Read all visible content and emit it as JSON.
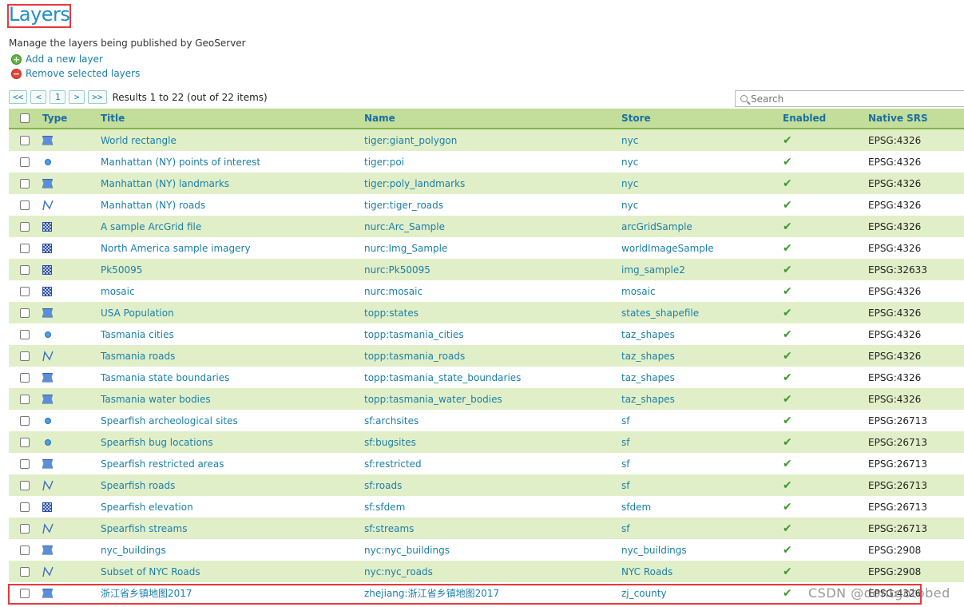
{
  "page": {
    "title": "Layers",
    "subtitle": "Manage the layers being published by GeoServer",
    "add_label": "Add a new layer",
    "remove_label": "Remove selected layers"
  },
  "pager": {
    "first": "<<",
    "prev": "<",
    "current": "1",
    "next": ">",
    "last": ">>",
    "results": "Results 1 to 22 (out of 22 items)"
  },
  "search": {
    "placeholder": "Search"
  },
  "columns": {
    "type": "Type",
    "title": "Title",
    "name": "Name",
    "store": "Store",
    "enabled": "Enabled",
    "srs": "Native SRS"
  },
  "enabled_mark": "✔",
  "rows": [
    {
      "type": "polygon",
      "title": "World rectangle",
      "name": "tiger:giant_polygon",
      "store": "nyc",
      "srs": "EPSG:4326"
    },
    {
      "type": "point",
      "title": "Manhattan (NY) points of interest",
      "name": "tiger:poi",
      "store": "nyc",
      "srs": "EPSG:4326"
    },
    {
      "type": "polygon",
      "title": "Manhattan (NY) landmarks",
      "name": "tiger:poly_landmarks",
      "store": "nyc",
      "srs": "EPSG:4326"
    },
    {
      "type": "line",
      "title": "Manhattan (NY) roads",
      "name": "tiger:tiger_roads",
      "store": "nyc",
      "srs": "EPSG:4326"
    },
    {
      "type": "raster",
      "title": "A sample ArcGrid file",
      "name": "nurc:Arc_Sample",
      "store": "arcGridSample",
      "srs": "EPSG:4326"
    },
    {
      "type": "raster",
      "title": "North America sample imagery",
      "name": "nurc:Img_Sample",
      "store": "worldImageSample",
      "srs": "EPSG:4326"
    },
    {
      "type": "raster",
      "title": "Pk50095",
      "name": "nurc:Pk50095",
      "store": "img_sample2",
      "srs": "EPSG:32633"
    },
    {
      "type": "raster",
      "title": "mosaic",
      "name": "nurc:mosaic",
      "store": "mosaic",
      "srs": "EPSG:4326"
    },
    {
      "type": "polygon",
      "title": "USA Population",
      "name": "topp:states",
      "store": "states_shapefile",
      "srs": "EPSG:4326"
    },
    {
      "type": "point",
      "title": "Tasmania cities",
      "name": "topp:tasmania_cities",
      "store": "taz_shapes",
      "srs": "EPSG:4326"
    },
    {
      "type": "line",
      "title": "Tasmania roads",
      "name": "topp:tasmania_roads",
      "store": "taz_shapes",
      "srs": "EPSG:4326"
    },
    {
      "type": "polygon",
      "title": "Tasmania state boundaries",
      "name": "topp:tasmania_state_boundaries",
      "store": "taz_shapes",
      "srs": "EPSG:4326"
    },
    {
      "type": "polygon",
      "title": "Tasmania water bodies",
      "name": "topp:tasmania_water_bodies",
      "store": "taz_shapes",
      "srs": "EPSG:4326"
    },
    {
      "type": "point",
      "title": "Spearfish archeological sites",
      "name": "sf:archsites",
      "store": "sf",
      "srs": "EPSG:26713"
    },
    {
      "type": "point",
      "title": "Spearfish bug locations",
      "name": "sf:bugsites",
      "store": "sf",
      "srs": "EPSG:26713"
    },
    {
      "type": "polygon",
      "title": "Spearfish restricted areas",
      "name": "sf:restricted",
      "store": "sf",
      "srs": "EPSG:26713"
    },
    {
      "type": "line",
      "title": "Spearfish roads",
      "name": "sf:roads",
      "store": "sf",
      "srs": "EPSG:26713"
    },
    {
      "type": "raster",
      "title": "Spearfish elevation",
      "name": "sf:sfdem",
      "store": "sfdem",
      "srs": "EPSG:26713"
    },
    {
      "type": "line",
      "title": "Spearfish streams",
      "name": "sf:streams",
      "store": "sf",
      "srs": "EPSG:26713"
    },
    {
      "type": "polygon",
      "title": "nyc_buildings",
      "name": "nyc:nyc_buildings",
      "store": "nyc_buildings",
      "srs": "EPSG:2908"
    },
    {
      "type": "line",
      "title": "Subset of NYC Roads",
      "name": "nyc:nyc_roads",
      "store": "NYC Roads",
      "srs": "EPSG:2908"
    },
    {
      "type": "polygon",
      "title": "浙江省乡镇地图2017",
      "name": "zhejiang:浙江省乡镇地图2017",
      "store": "zj_county",
      "srs": "EPSG:4326"
    }
  ],
  "watermark": "CSDN @dontgotobed",
  "colors": {
    "link": "#1a7fa8",
    "header_bg": "#c3dd9a",
    "row_alt": "#e1efc8",
    "highlight": "#e8383d"
  }
}
